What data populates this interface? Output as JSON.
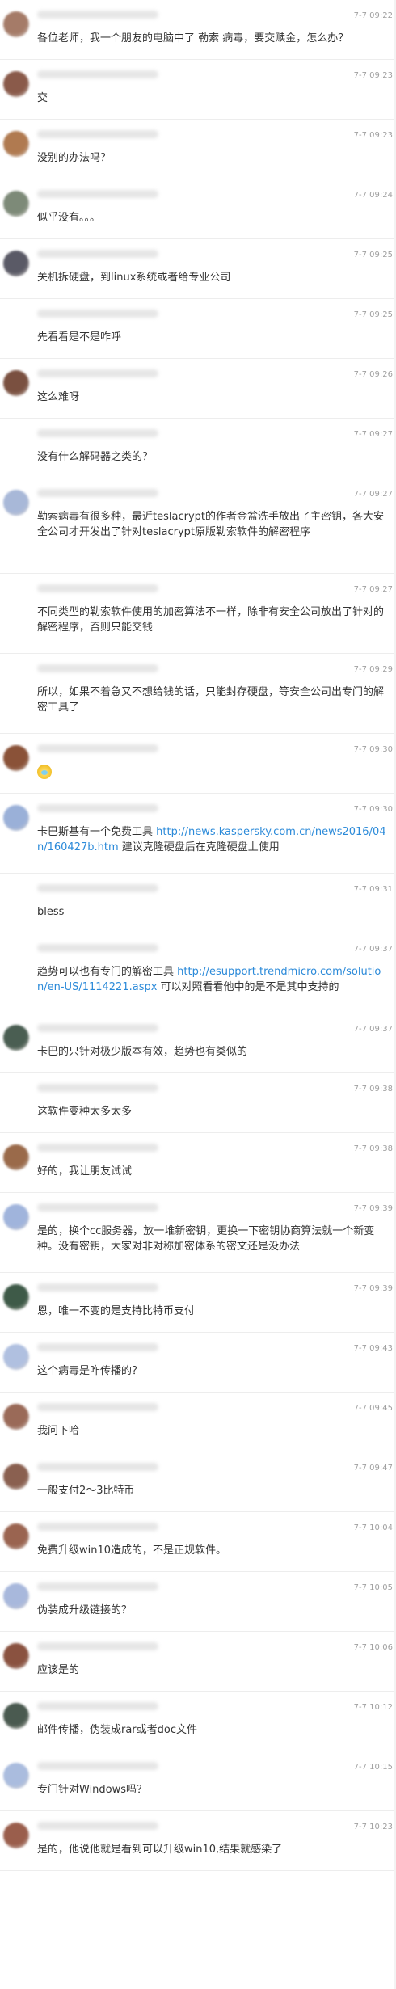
{
  "messages": [
    {
      "time": "7-7 09:22",
      "avatar_color": "#a57b68",
      "parts": [
        {
          "t": "各位老师，我一个朋友的电脑中了 勒索 病毒，要交赎金，怎么办？"
        }
      ]
    },
    {
      "time": "7-7 09:23",
      "avatar_color": "#8a5a4a",
      "parts": [
        {
          "t": "交"
        }
      ]
    },
    {
      "time": "7-7 09:23",
      "avatar_color": "#b07a50",
      "parts": [
        {
          "t": "没别的办法吗？"
        }
      ]
    },
    {
      "time": "7-7 09:24",
      "avatar_color": "#7d8a78",
      "parts": [
        {
          "t": "似乎没有。。。"
        }
      ]
    },
    {
      "time": "7-7 09:25",
      "avatar_color": "#5a5a66",
      "parts": [
        {
          "t": "关机拆硬盘，到linux系统或者给专业公司"
        }
      ]
    },
    {
      "time": "7-7 09:25",
      "avatar_color": "",
      "parts": [
        {
          "t": "先看看是不是咋呼"
        }
      ]
    },
    {
      "time": "7-7 09:26",
      "avatar_color": "#7a5040",
      "parts": [
        {
          "t": "这么难呀"
        }
      ]
    },
    {
      "time": "7-7 09:27",
      "avatar_color": "",
      "parts": [
        {
          "t": "没有什么解码器之类的？"
        }
      ]
    },
    {
      "time": "7-7 09:27",
      "avatar_color": "#a8b8d8",
      "parts": [
        {
          "t": "勒索病毒有很多种，最近teslacrypt的作者金盆洗手放出了主密钥，各大安全公司才开发出了针对teslacrypt原版勒索软件的解密程序"
        }
      ]
    },
    {
      "time": "7-7 09:27",
      "avatar_color": "",
      "parts": [
        {
          "t": "不同类型的勒索软件使用的加密算法不一样，除非有安全公司放出了针对的解密程序，否则只能交钱"
        }
      ]
    },
    {
      "time": "7-7 09:29",
      "avatar_color": "",
      "parts": [
        {
          "t": "所以，如果不着急又不想给钱的话，只能封存硬盘，等安全公司出专门的解密工具了"
        }
      ]
    },
    {
      "time": "7-7 09:30",
      "avatar_color": "#8a5238",
      "parts": [
        {
          "t": "",
          "emoji": true
        }
      ]
    },
    {
      "time": "7-7 09:30",
      "avatar_color": "#9ab0d8",
      "parts": [
        {
          "t": "卡巴斯基有一个免费工具 "
        },
        {
          "t": "http://news.kaspersky.com.cn/news2016/04n/160427b.htm",
          "link": true
        },
        {
          "t": " 建议克隆硬盘后在克隆硬盘上使用"
        }
      ]
    },
    {
      "time": "7-7 09:31",
      "avatar_color": "",
      "parts": [
        {
          "t": "bless"
        }
      ]
    },
    {
      "time": "7-7 09:37",
      "avatar_color": "",
      "parts": [
        {
          "t": "趋势可以也有专门的解密工具 "
        },
        {
          "t": "http://esupport.trendmicro.com/solution/en-US/1114221.aspx",
          "link": true
        },
        {
          "t": " 可以对照看看他中的是不是其中支持的"
        }
      ]
    },
    {
      "time": "7-7 09:37",
      "avatar_color": "#4a5e52",
      "parts": [
        {
          "t": "卡巴的只针对极少版本有效，趋势也有类似的"
        }
      ]
    },
    {
      "time": "7-7 09:38",
      "avatar_color": "",
      "parts": [
        {
          "t": "这软件变种太多太多"
        }
      ]
    },
    {
      "time": "7-7 09:38",
      "avatar_color": "#9a6a4a",
      "parts": [
        {
          "t": "好的，我让朋友试试"
        }
      ]
    },
    {
      "time": "7-7 09:39",
      "avatar_color": "#a0b4dc",
      "parts": [
        {
          "t": "是的，换个cc服务器，放一堆新密钥，更换一下密钥协商算法就一个新变种。没有密钥，大家对非对称加密体系的密文还是没办法"
        }
      ]
    },
    {
      "time": "7-7 09:39",
      "avatar_color": "#3e5a48",
      "parts": [
        {
          "t": "恩，唯一不变的是支持比特币支付"
        }
      ]
    },
    {
      "time": "7-7 09:43",
      "avatar_color": "#b0c0e0",
      "parts": [
        {
          "t": "这个病毒是咋传播的？"
        }
      ]
    },
    {
      "time": "7-7 09:45",
      "avatar_color": "#9a6a58",
      "parts": [
        {
          "t": "我问下哈"
        }
      ]
    },
    {
      "time": "7-7 09:47",
      "avatar_color": "#8a6050",
      "parts": [
        {
          "t": "一般支付2～3比特币"
        }
      ]
    },
    {
      "time": "7-7 10:04",
      "avatar_color": "#9a6450",
      "parts": [
        {
          "t": "免费升级win10造成的，不是正规软件。"
        }
      ]
    },
    {
      "time": "7-7 10:05",
      "avatar_color": "#a8b8dc",
      "parts": [
        {
          "t": "伪装成升级链接的？"
        }
      ]
    },
    {
      "time": "7-7 10:06",
      "avatar_color": "#8a5240",
      "parts": [
        {
          "t": "应该是的"
        }
      ]
    },
    {
      "time": "7-7 10:12",
      "avatar_color": "#4a5a50",
      "parts": [
        {
          "t": "邮件传播，伪装成rar或者doc文件"
        }
      ]
    },
    {
      "time": "7-7 10:15",
      "avatar_color": "#aabcde",
      "parts": [
        {
          "t": "专门针对Windows吗？"
        }
      ]
    },
    {
      "time": "7-7 10:23",
      "avatar_color": "#9a5e4c",
      "parts": [
        {
          "t": "是的，他说他就是看到可以升级win10,结果就感染了"
        }
      ]
    }
  ]
}
